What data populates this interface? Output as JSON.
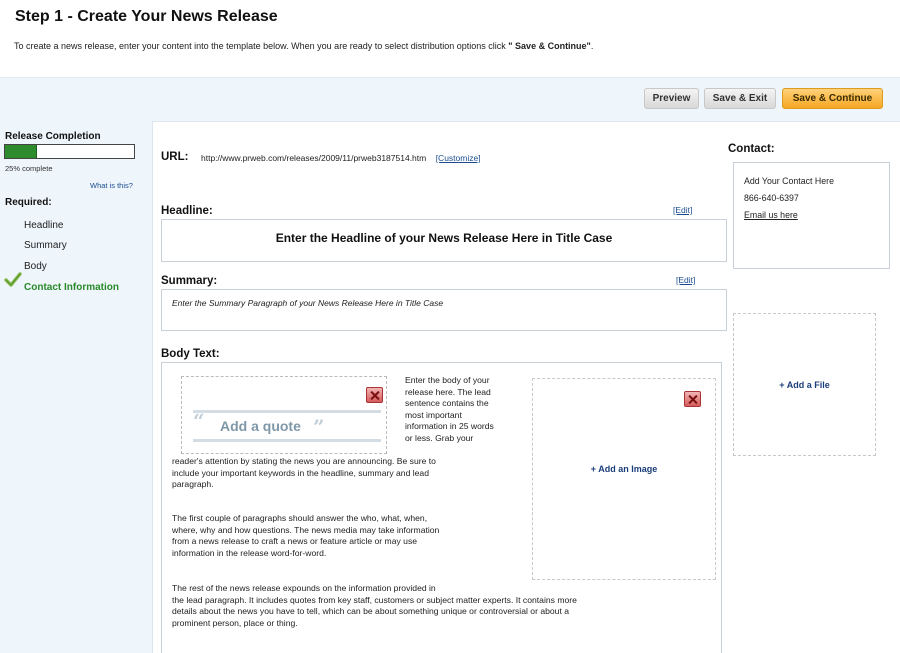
{
  "header": {
    "title": "Step 1 - Create Your News Release",
    "intro_before": "To create a news release, enter your content into the template below. When you are ready to select distribution options click ",
    "intro_bold": "\" Save & Continue\"",
    "intro_after": "."
  },
  "toolbar": {
    "preview_label": "Preview",
    "save_exit_label": "Save & Exit",
    "save_continue_label": "Save & Continue"
  },
  "sidebar": {
    "completion_title": "Release Completion",
    "completion_percent": 25,
    "completion_text": "25%  complete",
    "what_is_this": "What is this?",
    "required_title": "Required:",
    "items": [
      {
        "label": "Headline",
        "done": false
      },
      {
        "label": "Summary",
        "done": false
      },
      {
        "label": "Body",
        "done": false
      },
      {
        "label": "Contact Information",
        "done": true
      }
    ],
    "done_color": "#2a8a2a"
  },
  "form": {
    "url_label": "URL:",
    "url_value": "http://www.prweb.com/releases/2009/11/prweb3187514.htm",
    "customize_label": "[Customize]",
    "headline_label": "Headline:",
    "headline_edit": "[Edit]",
    "headline_placeholder": "Enter the Headline of your News Release Here in Title Case",
    "summary_label": "Summary:",
    "summary_edit": "[Edit]",
    "summary_placeholder": "Enter the Summary  Paragraph  of your News Release Here in Title Case",
    "body_label": "Body Text:",
    "quote_label": "Add a quote",
    "add_image_label": "+ Add an Image",
    "body_paragraphs": [
      [
        "Enter the body of your",
        "release here. The lead",
        "sentence contains the",
        "most important",
        "information in 25 words",
        "or less.  Grab your"
      ],
      [
        "reader's attention by stating the news you are announcing. Be sure to",
        "include your important keywords in the headline, summary and lead",
        "paragraph."
      ],
      [
        "The first couple of paragraphs should answer  the who, what, when,",
        "where, why and how questions.  The news media may take information",
        "from a news release  to craft a news or feature article or may use",
        "information in the release word-for-word."
      ],
      [
        "The rest of the news release expounds on the information provided in",
        "the lead paragraph. It includes quotes from key staff, customers or subject matter experts. It contains more",
        "details about the news you have to tell, which can be about something unique or controversial or about a",
        "prominent person, place or thing."
      ]
    ]
  },
  "contact": {
    "label": "Contact:",
    "name": "Add Your Contact Here",
    "phone": "866-640-6397",
    "email_link": "Email us here",
    "add_file_label": "+ Add a File"
  }
}
